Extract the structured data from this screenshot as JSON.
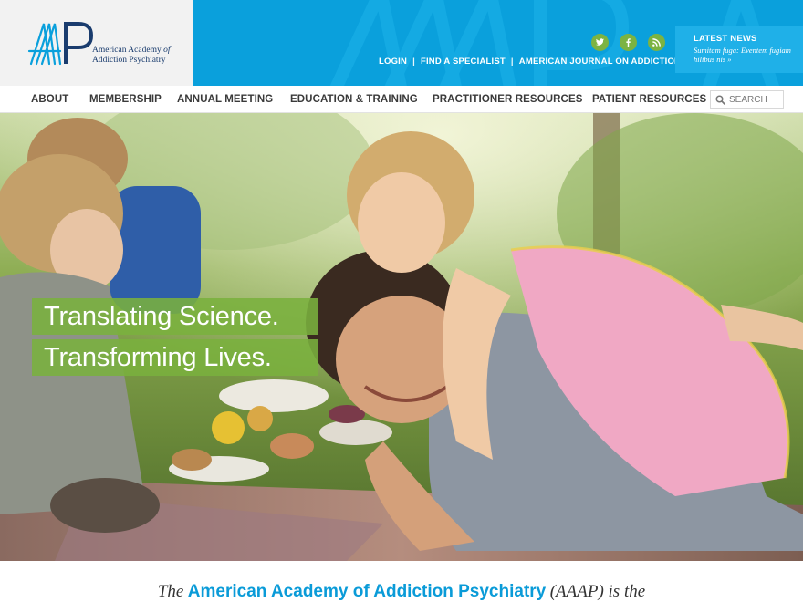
{
  "logo": {
    "monogram": "AAAP",
    "name_line1": "American Academy",
    "name_line1_of": "of",
    "name_line2": "Addiction Psychiatry"
  },
  "colors": {
    "brand_blue": "#0aa0dc",
    "accent_green": "#7cb342",
    "nav_text": "#3a3a3a"
  },
  "social": [
    {
      "name": "twitter-icon"
    },
    {
      "name": "facebook-icon"
    },
    {
      "name": "rss-icon"
    }
  ],
  "utility_nav": {
    "login": "LOGIN",
    "find_specialist": "FIND A SPECIALIST",
    "journal": "AMERICAN JOURNAL ON ADDICTIONS",
    "separator": "|"
  },
  "latest_news": {
    "title": "LATEST NEWS",
    "teaser": "Sumitam fuga: Eventem fugiam hilibus nis »"
  },
  "main_nav": {
    "items": [
      {
        "label": "ABOUT"
      },
      {
        "label": "MEMBERSHIP"
      },
      {
        "label": "ANNUAL MEETING"
      },
      {
        "label": "EDUCATION & TRAINING"
      },
      {
        "label": "PRACTITIONER RESOURCES"
      },
      {
        "label": "PATIENT RESOURCES"
      }
    ]
  },
  "search": {
    "placeholder": "SEARCH"
  },
  "hero": {
    "tagline_line1": "Translating Science.",
    "tagline_line2": "Transforming Lives."
  },
  "intro": {
    "prefix": "The",
    "org_name": "American Academy of Addiction Psychiatry",
    "suffix": "(AAAP) is the"
  }
}
